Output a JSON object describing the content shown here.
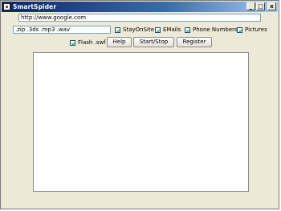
{
  "window": {
    "title": "SmartSpider",
    "minimize_glyph": "_",
    "maximize_glyph": "□",
    "close_glyph": "x"
  },
  "url_input": {
    "value": "http://www.google.com"
  },
  "extensions_input": {
    "value": ".zip .3ds .mp3 .wav"
  },
  "options": [
    {
      "label": "StayOnSite",
      "checked": true
    },
    {
      "label": "EMails",
      "checked": true
    },
    {
      "label": "Phone Numbers",
      "checked": true
    },
    {
      "label": "Pictures",
      "checked": true
    },
    {
      "label": "Flash .swf",
      "checked": true
    }
  ],
  "buttons": {
    "help": "Help",
    "start_stop": "Start/Stop",
    "register": "Register"
  },
  "output_area": {
    "value": ""
  }
}
